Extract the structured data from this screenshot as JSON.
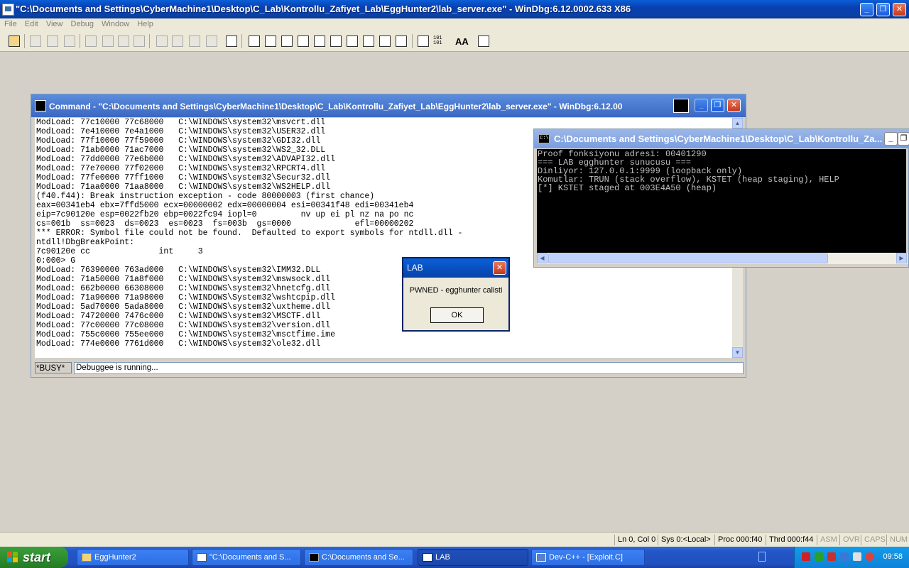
{
  "main_window": {
    "title": "\"C:\\Documents and Settings\\CyberMachine1\\Desktop\\C_Lab\\Kontrollu_Zafiyet_Lab\\EggHunter2\\lab_server.exe\" - WinDbg:6.12.0002.633 X86"
  },
  "menu": [
    "File",
    "Edit",
    "View",
    "Debug",
    "Window",
    "Help"
  ],
  "toolbar": {
    "icons": [
      "open-icon",
      "cut-icon",
      "copy-icon",
      "paste-icon",
      "go-icon",
      "restart-icon",
      "stop-debugging-icon",
      "break-icon",
      "step-into-icon",
      "step-over-icon",
      "step-out-icon",
      "run-to-cursor-icon",
      "hand-icon",
      "command-icon",
      "watch-icon",
      "locals-icon",
      "registers-icon",
      "memory-icon",
      "call-stack-icon",
      "disassembly-icon",
      "scratch-pad-icon",
      "processes-icon",
      "source-mode-icon",
      "hex-icon",
      "font-icon",
      "options-icon"
    ],
    "hex_label": "101 101",
    "font_label": "AA"
  },
  "command_window": {
    "title": "Command - \"C:\\Documents and Settings\\CyberMachine1\\Desktop\\C_Lab\\Kontrollu_Zafiyet_Lab\\EggHunter2\\lab_server.exe\" - WinDbg:6.12.00",
    "output": "ModLoad: 77c10000 77c68000   C:\\WINDOWS\\system32\\msvcrt.dll\nModLoad: 7e410000 7e4a1000   C:\\WINDOWS\\system32\\USER32.dll\nModLoad: 77f10000 77f59000   C:\\WINDOWS\\system32\\GDI32.dll\nModLoad: 71ab0000 71ac7000   C:\\WINDOWS\\system32\\WS2_32.DLL\nModLoad: 77dd0000 77e6b000   C:\\WINDOWS\\system32\\ADVAPI32.dll\nModLoad: 77e70000 77f02000   C:\\WINDOWS\\system32\\RPCRT4.dll\nModLoad: 77fe0000 77ff1000   C:\\WINDOWS\\system32\\Secur32.dll\nModLoad: 71aa0000 71aa8000   C:\\WINDOWS\\system32\\WS2HELP.dll\n(f40.f44): Break instruction exception - code 80000003 (first chance)\neax=00341eb4 ebx=7ffd5000 ecx=00000002 edx=00000004 esi=00341f48 edi=00341eb4\neip=7c90120e esp=0022fb20 ebp=0022fc94 iopl=0         nv up ei pl nz na po nc\ncs=001b  ss=0023  ds=0023  es=0023  fs=003b  gs=0000             efl=00000202\n*** ERROR: Symbol file could not be found.  Defaulted to export symbols for ntdll.dll -\nntdll!DbgBreakPoint:\n7c90120e cc              int     3\n0:000> G\nModLoad: 76390000 763ad000   C:\\WINDOWS\\system32\\IMM32.DLL\nModLoad: 71a50000 71a8f000   C:\\WINDOWS\\system32\\mswsock.dll\nModLoad: 662b0000 66308000   C:\\WINDOWS\\system32\\hnetcfg.dll\nModLoad: 71a90000 71a98000   C:\\WINDOWS\\System32\\wshtcpip.dll\nModLoad: 5ad70000 5ada8000   C:\\WINDOWS\\system32\\uxtheme.dll\nModLoad: 74720000 7476c000   C:\\WINDOWS\\system32\\MSCTF.dll\nModLoad: 77c00000 77c08000   C:\\WINDOWS\\system32\\version.dll\nModLoad: 755c0000 755ee000   C:\\WINDOWS\\system32\\msctfime.ime\nModLoad: 774e0000 7761d000   C:\\WINDOWS\\system32\\ole32.dll",
    "busy_label": "*BUSY*",
    "input_value": "Debuggee is running..."
  },
  "console_window": {
    "title": "C:\\Documents and Settings\\CyberMachine1\\Desktop\\C_Lab\\Kontrollu_Za...",
    "icon_label": "C:\\",
    "output": "Proof fonksiyonu adresi: 00401290\n=== LAB egghunter sunucusu ===\nDinliyor: 127.0.0.1:9999 (loopback only)\nKomutlar: TRUN (stack overflow), KSTET (heap staging), HELP\n[*] KSTET staged at 003E4A50 (heap)"
  },
  "lab_dialog": {
    "title": "LAB",
    "message": "PWNED - egghunter calisti",
    "ok_label": "OK"
  },
  "status_bar": {
    "ln_col": "Ln 0, Col 0",
    "sys": "Sys 0:<Local>",
    "proc": "Proc 000:f40",
    "thrd": "Thrd 000:f44",
    "asm": "ASM",
    "ovr": "OVR",
    "caps": "CAPS",
    "num": "NUM"
  },
  "taskbar": {
    "start_label": "start",
    "tasks": [
      {
        "label": "EggHunter2",
        "icon": "folder-icon"
      },
      {
        "label": "\"C:\\Documents and S...",
        "icon": "windbg-icon"
      },
      {
        "label": "C:\\Documents and Se...",
        "icon": "console-icon"
      },
      {
        "label": "LAB",
        "icon": "window-icon"
      },
      {
        "label": "Dev-C++ - [Exploit.C]",
        "icon": "devcpp-icon"
      }
    ],
    "clock": "09:58"
  },
  "colors": {
    "title_active": "#0a3fb0",
    "console_bg": "#000000",
    "console_fg": "#c0c0c0",
    "taskbar": "#245edb",
    "start_green": "#2f8f2f"
  }
}
